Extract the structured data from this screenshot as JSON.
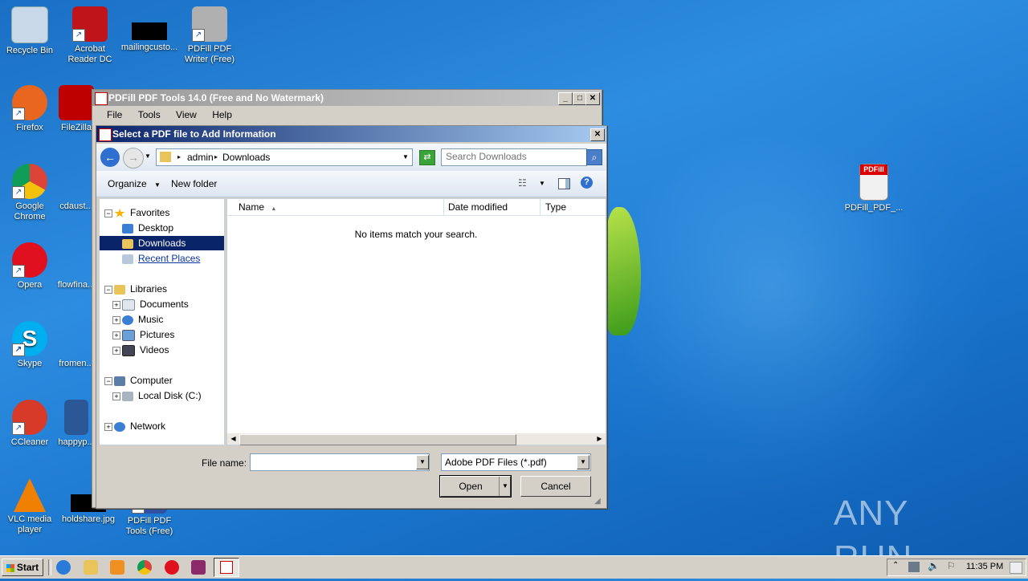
{
  "desktop": {
    "icons": [
      {
        "label": "Recycle Bin",
        "icon": "recycle-bin-icon",
        "color": "#c8d8e8"
      },
      {
        "label": "Acrobat Reader DC",
        "icon": "acrobat-icon",
        "color": "#c0141b"
      },
      {
        "label": "mailingcusto...",
        "icon": "file-thumbnail-icon",
        "color": "#000000"
      },
      {
        "label": "PDFill PDF Writer (Free)",
        "icon": "pdfill-writer-icon",
        "color": "#b0b0b0"
      },
      {
        "label": "Firefox",
        "icon": "firefox-icon",
        "color": "#e8661e"
      },
      {
        "label": "FileZilla",
        "icon": "filezilla-icon",
        "color": "#bf0000"
      },
      {
        "label": "Google Chrome",
        "icon": "chrome-icon",
        "color": "#2a9d3e"
      },
      {
        "label": "cdaust...",
        "icon": "file-icon",
        "color": "#e0e0e0"
      },
      {
        "label": "Opera",
        "icon": "opera-icon",
        "color": "#e0101e"
      },
      {
        "label": "flowfina...",
        "icon": "file-icon",
        "color": "#e0e0e0"
      },
      {
        "label": "Skype",
        "icon": "skype-icon",
        "color": "#00aff0"
      },
      {
        "label": "fromen...",
        "icon": "file-icon",
        "color": "#e0e0e0"
      },
      {
        "label": "CCleaner",
        "icon": "ccleaner-icon",
        "color": "#d83a2a"
      },
      {
        "label": "happyp...",
        "icon": "word-doc-icon",
        "color": "#2b5797"
      },
      {
        "label": "VLC media player",
        "icon": "vlc-icon",
        "color": "#f08000"
      },
      {
        "label": "holdshare.jpg",
        "icon": "image-file-icon",
        "color": "#000000"
      },
      {
        "label": "PDFill PDF Tools (Free)",
        "icon": "pdfill-tools-icon",
        "color": "#3050a0"
      },
      {
        "label": "PDFill_PDF_...",
        "icon": "pdfill-installer-icon",
        "color": "#d0d0d0"
      }
    ]
  },
  "app_window": {
    "title": "PDFill PDF Tools 14.0 (Free and No Watermark)",
    "menu": [
      "File",
      "Tools",
      "View",
      "Help"
    ]
  },
  "dialog": {
    "title": "Select a PDF file to Add Information",
    "breadcrumb": [
      "admin",
      "Downloads"
    ],
    "search_placeholder": "Search Downloads",
    "organize_label": "Organize",
    "new_folder_label": "New folder",
    "nav": {
      "favorites": "Favorites",
      "desktop": "Desktop",
      "downloads": "Downloads",
      "recent_places": "Recent Places",
      "libraries": "Libraries",
      "documents": "Documents",
      "music": "Music",
      "pictures": "Pictures",
      "videos": "Videos",
      "computer": "Computer",
      "local_disk": "Local Disk (C:)",
      "network": "Network"
    },
    "columns": [
      "Name",
      "Date modified",
      "Type"
    ],
    "empty_message": "No items match your search.",
    "file_name_label": "File name:",
    "file_name_value": "",
    "file_type": "Adobe PDF Files (*.pdf)",
    "open_label": "Open",
    "cancel_label": "Cancel"
  },
  "taskbar": {
    "start_label": "Start",
    "clock": "11:35 PM"
  },
  "watermark": "ANY RUN"
}
